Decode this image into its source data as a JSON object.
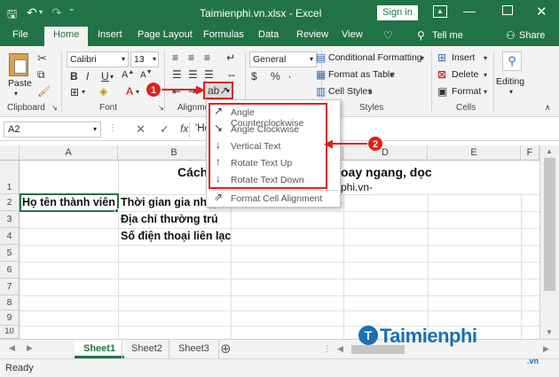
{
  "window": {
    "title": "Taimienphi.vn.xlsx - Excel",
    "sign_in": "Sign in",
    "tell_me": "Tell me",
    "share": "Share"
  },
  "tabs": [
    "File",
    "Home",
    "Insert",
    "Page Layout",
    "Formulas",
    "Data",
    "Review",
    "View"
  ],
  "ribbon": {
    "paste": "Paste",
    "clipboard": "Clipboard",
    "font_name": "Calibri",
    "font_size": "13",
    "font": "Font",
    "bold": "B",
    "italic": "I",
    "underline": "U",
    "alignment": "Alignme",
    "number_format": "General",
    "conditional_formatting": "Conditional Formatting",
    "format_as_table": "Format as Table",
    "cell_styles": "Cell Styles",
    "styles": "Styles",
    "insert": "Insert",
    "delete": "Delete",
    "format": "Format",
    "cells": "Cells",
    "editing": "Editing"
  },
  "formula_bar": {
    "name_box": "A2",
    "fx": "fx",
    "content": "'Họ"
  },
  "columns": [
    "A",
    "B",
    "C",
    "D",
    "E",
    "F"
  ],
  "rows": [
    "1",
    "2",
    "3",
    "4",
    "5",
    "6",
    "7",
    "8",
    "9",
    "10"
  ],
  "cells": {
    "b1_title_left": "Cách",
    "b1_title_right": "oay ngang, dọc",
    "b1_sub": "phi.vn-",
    "a2": "Họ tên thành viên",
    "b2": "Thời gian gia nhập",
    "b3": "Địa chỉ thường trú",
    "b4": "Số điện thoại liên lạc"
  },
  "orientation_menu": [
    "Angle Counterclockwise",
    "Angle Clockwise",
    "Vertical Text",
    "Rotate Text Up",
    "Rotate Text Down",
    "Format Cell Alignment"
  ],
  "callouts": [
    "1",
    "2"
  ],
  "sheets": [
    "Sheet1",
    "Sheet2",
    "Sheet3"
  ],
  "status": "Ready",
  "watermark": "Taimienphi",
  "watermark_suffix": ".vn",
  "colors": {
    "excel_green": "#217346",
    "callout_red": "#e0201a",
    "watermark_blue": "#1a6fb5"
  }
}
